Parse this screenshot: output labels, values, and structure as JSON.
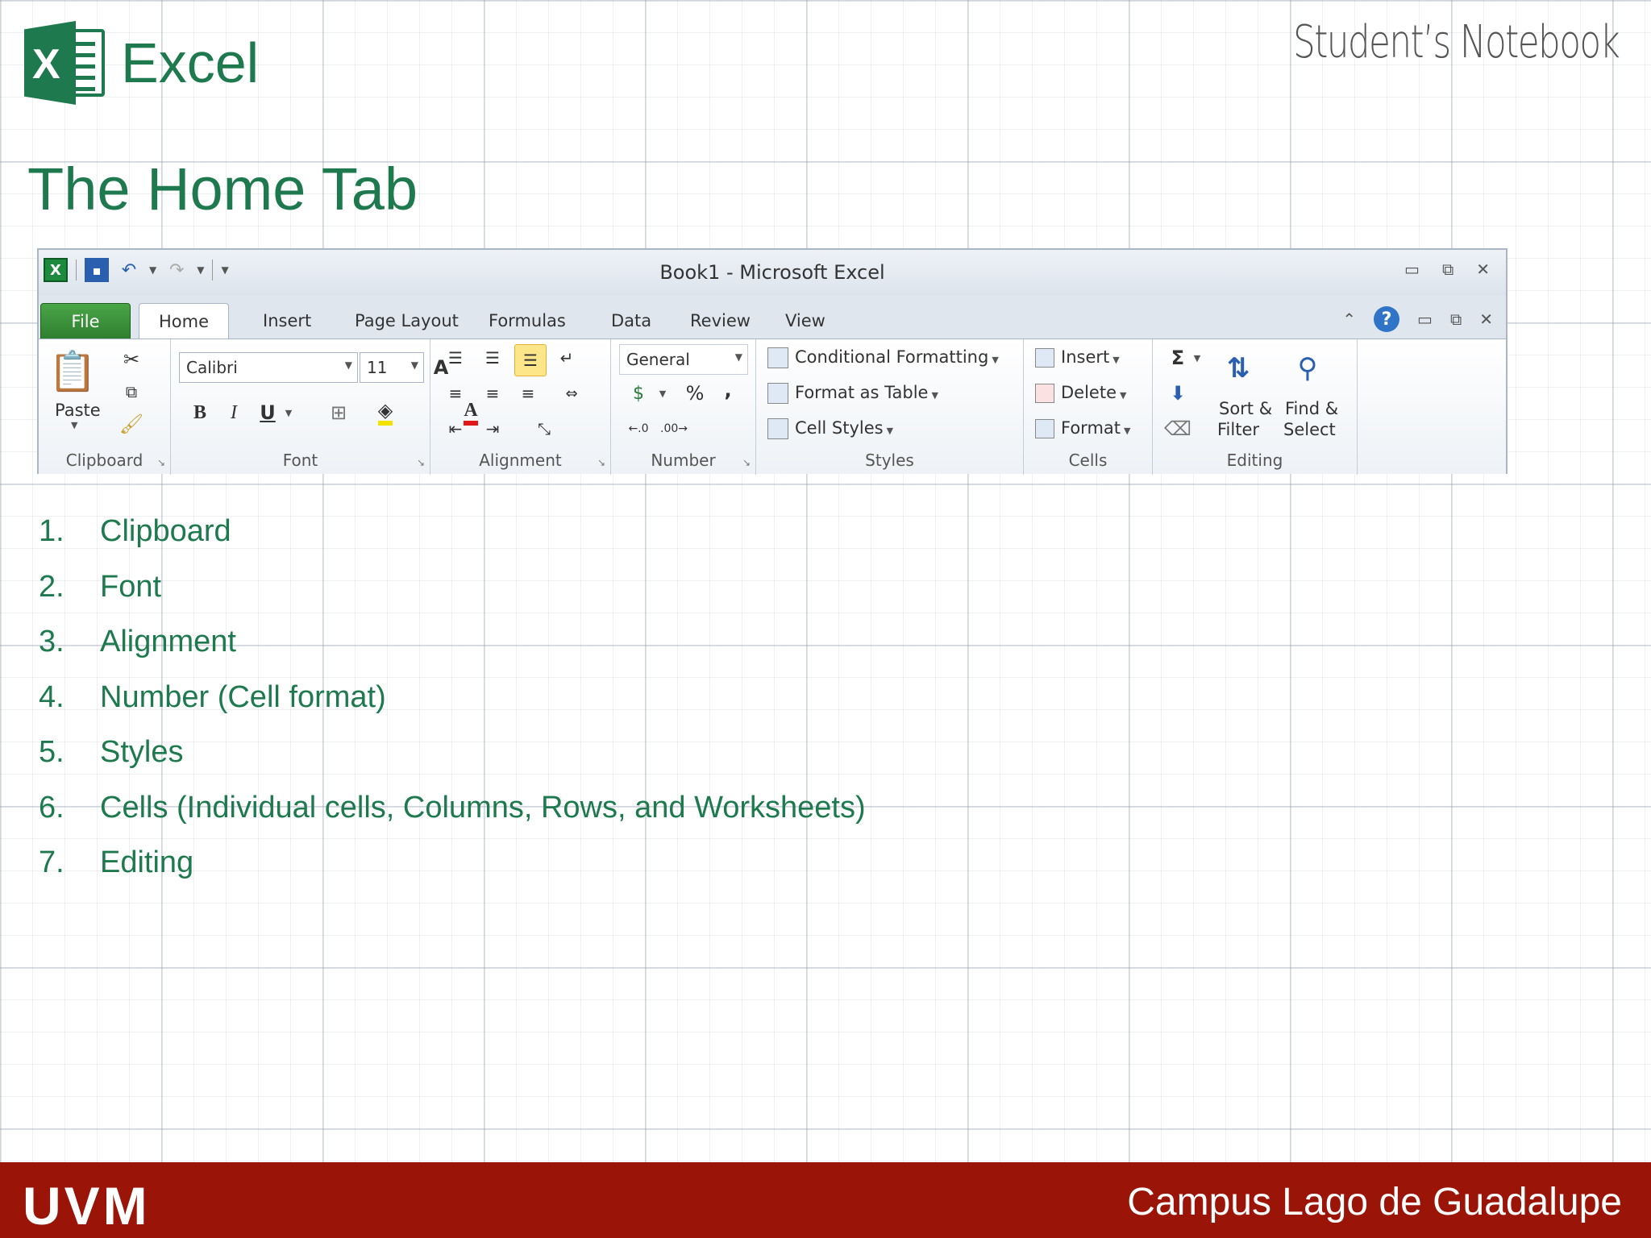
{
  "header": {
    "app_name": "Excel",
    "notebook_label": "Student’s Notebook",
    "page_title": "The Home Tab"
  },
  "excel_window": {
    "title": "Book1  -  Microsoft Excel",
    "tabs": [
      "File",
      "Home",
      "Insert",
      "Page Layout",
      "Formulas",
      "Data",
      "Review",
      "View"
    ],
    "active_tab": "Home",
    "groups": {
      "clipboard": {
        "label": "Clipboard",
        "paste": "Paste"
      },
      "font": {
        "label": "Font",
        "font_name": "Calibri",
        "font_size": "11",
        "bold": "B",
        "italic": "I",
        "underline": "U"
      },
      "alignment": {
        "label": "Alignment"
      },
      "number": {
        "label": "Number",
        "format": "General",
        "percent": "%",
        "comma": ","
      },
      "styles": {
        "label": "Styles",
        "conditional_formatting": "Conditional Formatting",
        "format_as_table": "Format as Table",
        "cell_styles": "Cell Styles"
      },
      "cells": {
        "label": "Cells",
        "insert": "Insert",
        "delete": "Delete",
        "format": "Format"
      },
      "editing": {
        "label": "Editing",
        "sort_filter_1": "Sort &",
        "sort_filter_2": "Filter",
        "find_select_1": "Find &",
        "find_select_2": "Select"
      }
    }
  },
  "list": [
    {
      "num": "1.",
      "text": "Clipboard"
    },
    {
      "num": "2.",
      "text": "Font"
    },
    {
      "num": "3.",
      "text": "Alignment"
    },
    {
      "num": "4.",
      "text": "Number (Cell format)"
    },
    {
      "num": "5.",
      "text": "Styles"
    },
    {
      "num": "6.",
      "text": "Cells (Individual cells, Columns, Rows, and Worksheets)"
    },
    {
      "num": "7.",
      "text": "Editing"
    }
  ],
  "footer": {
    "brand": "UVM",
    "campus": "Campus Lago de Guadalupe"
  },
  "colors": {
    "accent_green": "#1e7a4e",
    "footer_red": "#9b1408"
  }
}
